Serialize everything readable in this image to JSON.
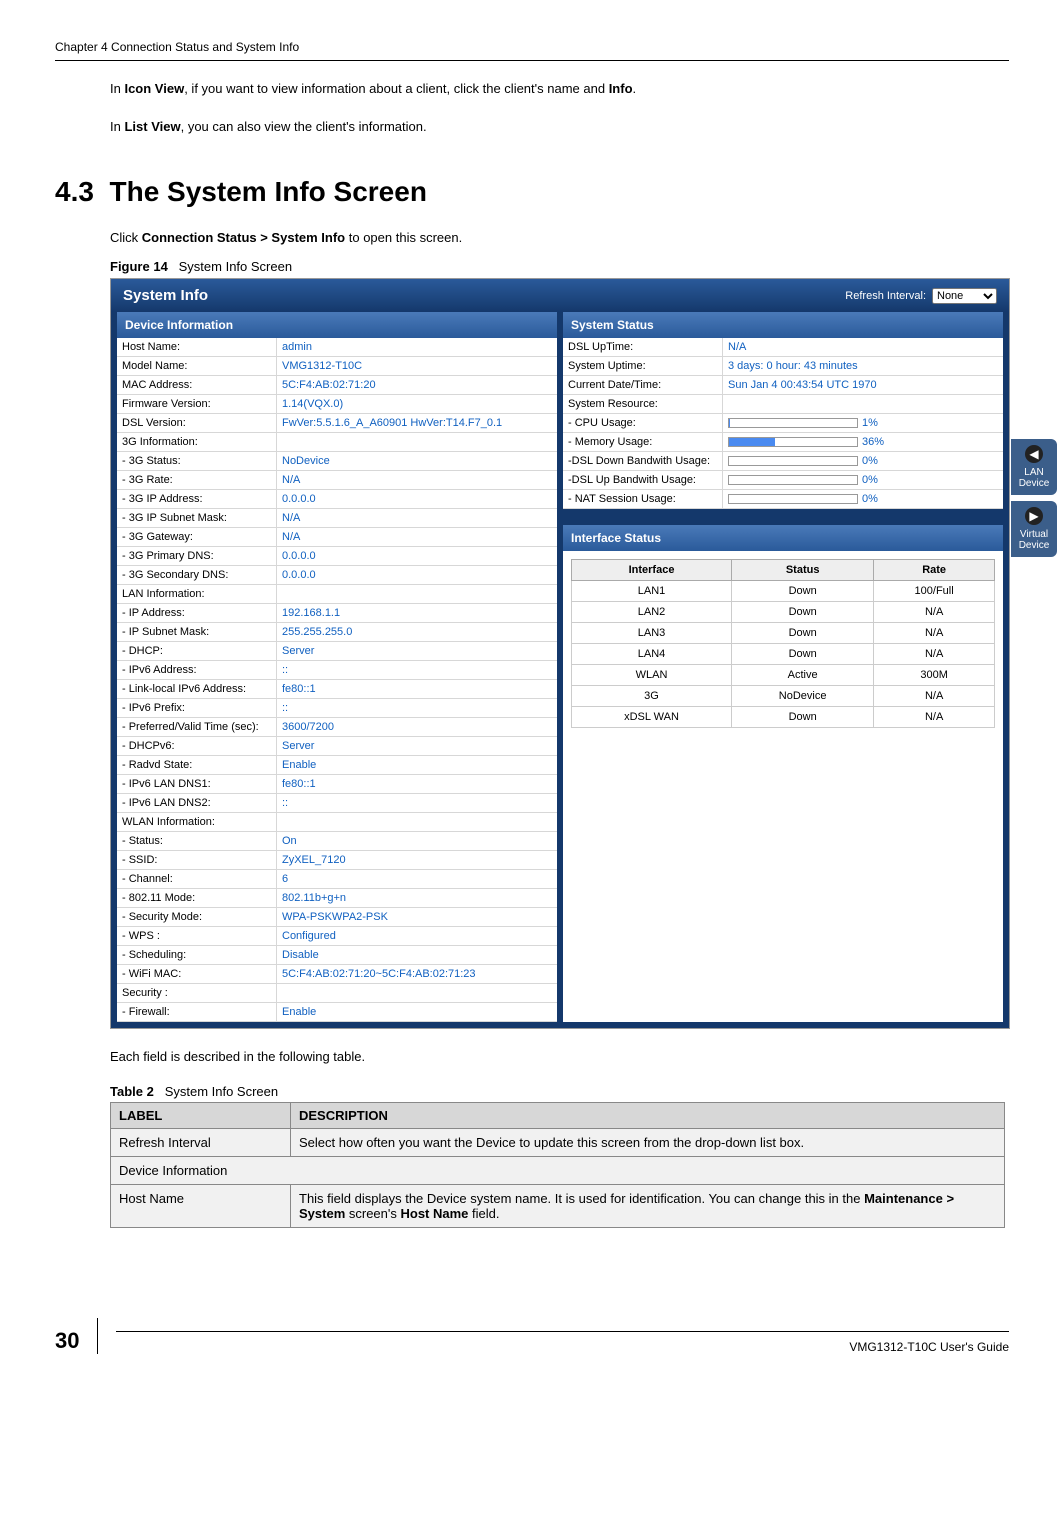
{
  "header": {
    "chapter": "Chapter 4 Connection Status and System Info"
  },
  "paragraphs": {
    "p1_pre": "In ",
    "p1_b1": "Icon View",
    "p1_mid": ", if you want to view information about a client, click the client's name and ",
    "p1_b2": "Info",
    "p1_post": ".",
    "p2_pre": "In ",
    "p2_b1": "List View",
    "p2_post": ", you can also view the client's information."
  },
  "section": {
    "number": "4.3",
    "title": "The System Info Screen"
  },
  "callout": {
    "pre": "Click ",
    "b1": "Connection Status > System Info",
    "post": " to open this screen."
  },
  "figure": {
    "label_b": "Figure 14",
    "label_t": "System Info Screen"
  },
  "screenshot": {
    "title": "System Info",
    "refresh_label": "Refresh Interval:",
    "refresh_value": "None",
    "panel_dev": "Device Information",
    "dev_rows": [
      {
        "l": "Host Name:",
        "v": "admin"
      },
      {
        "l": "Model Name:",
        "v": "VMG1312-T10C"
      },
      {
        "l": "MAC Address:",
        "v": "5C:F4:AB:02:71:20"
      },
      {
        "l": "Firmware Version:",
        "v": "1.14(VQX.0)"
      },
      {
        "l": "DSL Version:",
        "v": "FwVer:5.5.1.6_A_A60901 HwVer:T14.F7_0.1"
      },
      {
        "l": "3G Information:",
        "v": ""
      },
      {
        "l": " - 3G Status:",
        "v": "NoDevice"
      },
      {
        "l": " - 3G Rate:",
        "v": "N/A"
      },
      {
        "l": " - 3G IP Address:",
        "v": "0.0.0.0"
      },
      {
        "l": " - 3G IP Subnet Mask:",
        "v": "N/A"
      },
      {
        "l": " - 3G Gateway:",
        "v": "N/A"
      },
      {
        "l": " - 3G Primary DNS:",
        "v": "0.0.0.0"
      },
      {
        "l": " - 3G Secondary DNS:",
        "v": "0.0.0.0"
      },
      {
        "l": "LAN Information:",
        "v": ""
      },
      {
        "l": " - IP Address:",
        "v": "192.168.1.1"
      },
      {
        "l": " - IP Subnet Mask:",
        "v": "255.255.255.0"
      },
      {
        "l": " - DHCP:",
        "v": "Server"
      },
      {
        "l": " - IPv6 Address:",
        "v": "::"
      },
      {
        "l": " - Link-local IPv6 Address:",
        "v": "fe80::1"
      },
      {
        "l": " - IPv6 Prefix:",
        "v": "::"
      },
      {
        "l": " - Preferred/Valid Time (sec):",
        "v": "3600/7200"
      },
      {
        "l": " - DHCPv6:",
        "v": "Server"
      },
      {
        "l": " - Radvd State:",
        "v": "Enable"
      },
      {
        "l": " - IPv6 LAN DNS1:",
        "v": "fe80::1"
      },
      {
        "l": " - IPv6 LAN DNS2:",
        "v": "::"
      },
      {
        "l": "WLAN Information:",
        "v": ""
      },
      {
        "l": " - Status:",
        "v": "On"
      },
      {
        "l": " - SSID:",
        "v": "ZyXEL_7120"
      },
      {
        "l": " - Channel:",
        "v": "6"
      },
      {
        "l": " - 802.11 Mode:",
        "v": "802.11b+g+n"
      },
      {
        "l": " - Security Mode:",
        "v": "WPA-PSKWPA2-PSK"
      },
      {
        "l": " - WPS :",
        "v": "Configured"
      },
      {
        "l": " - Scheduling:",
        "v": "Disable"
      },
      {
        "l": " - WiFi MAC:",
        "v": "5C:F4:AB:02:71:20~5C:F4:AB:02:71:23"
      },
      {
        "l": "Security :",
        "v": ""
      },
      {
        "l": " - Firewall:",
        "v": "Enable"
      }
    ],
    "panel_sys": "System Status",
    "sys_rows": [
      {
        "l": "DSL UpTime:",
        "v": "N/A",
        "bar": false
      },
      {
        "l": "System Uptime:",
        "v": "3 days: 0 hour: 43 minutes",
        "bar": false
      },
      {
        "l": "Current Date/Time:",
        "v": "Sun Jan 4 00:43:54 UTC 1970",
        "bar": false
      },
      {
        "l": "System Resource:",
        "v": "",
        "bar": false
      },
      {
        "l": " - CPU Usage:",
        "v": "1%",
        "bar": true,
        "pct": 1
      },
      {
        "l": " - Memory Usage:",
        "v": "36%",
        "bar": true,
        "pct": 36
      },
      {
        "l": " -DSL Down Bandwith Usage:",
        "v": "0%",
        "bar": true,
        "pct": 0
      },
      {
        "l": " -DSL Up Bandwith Usage:",
        "v": "0%",
        "bar": true,
        "pct": 0
      },
      {
        "l": " - NAT Session Usage:",
        "v": "0%",
        "bar": true,
        "pct": 0
      }
    ],
    "panel_iface": "Interface Status",
    "iface_head": [
      "Interface",
      "Status",
      "Rate"
    ],
    "iface_rows": [
      [
        "LAN1",
        "Down",
        "100/Full"
      ],
      [
        "LAN2",
        "Down",
        "N/A"
      ],
      [
        "LAN3",
        "Down",
        "N/A"
      ],
      [
        "LAN4",
        "Down",
        "N/A"
      ],
      [
        "WLAN",
        "Active",
        "300M"
      ],
      [
        "3G",
        "NoDevice",
        "N/A"
      ],
      [
        "xDSL WAN",
        "Down",
        "N/A"
      ]
    ],
    "tab_lan": "LAN Device",
    "tab_virtual": "Virtual Device"
  },
  "after_fig": "Each field is described in the following table.",
  "table2": {
    "label_b": "Table 2",
    "label_t": "System Info Screen",
    "head_label": "LABEL",
    "head_desc": "DESCRIPTION",
    "rows": [
      {
        "l": "Refresh Interval",
        "d": "Select how often you want the Device to update this screen from the drop-down list box."
      },
      {
        "l": "Device Information",
        "d": ""
      },
      {
        "l": "Host Name",
        "d_pre": "This field displays the Device system name. It is used for identification. You can change this in the ",
        "d_b1": "Maintenance > System",
        "d_mid": " screen's ",
        "d_b2": "Host Name",
        "d_post": " field."
      }
    ]
  },
  "footer": {
    "page": "30",
    "guide": "VMG1312-T10C User's Guide"
  }
}
